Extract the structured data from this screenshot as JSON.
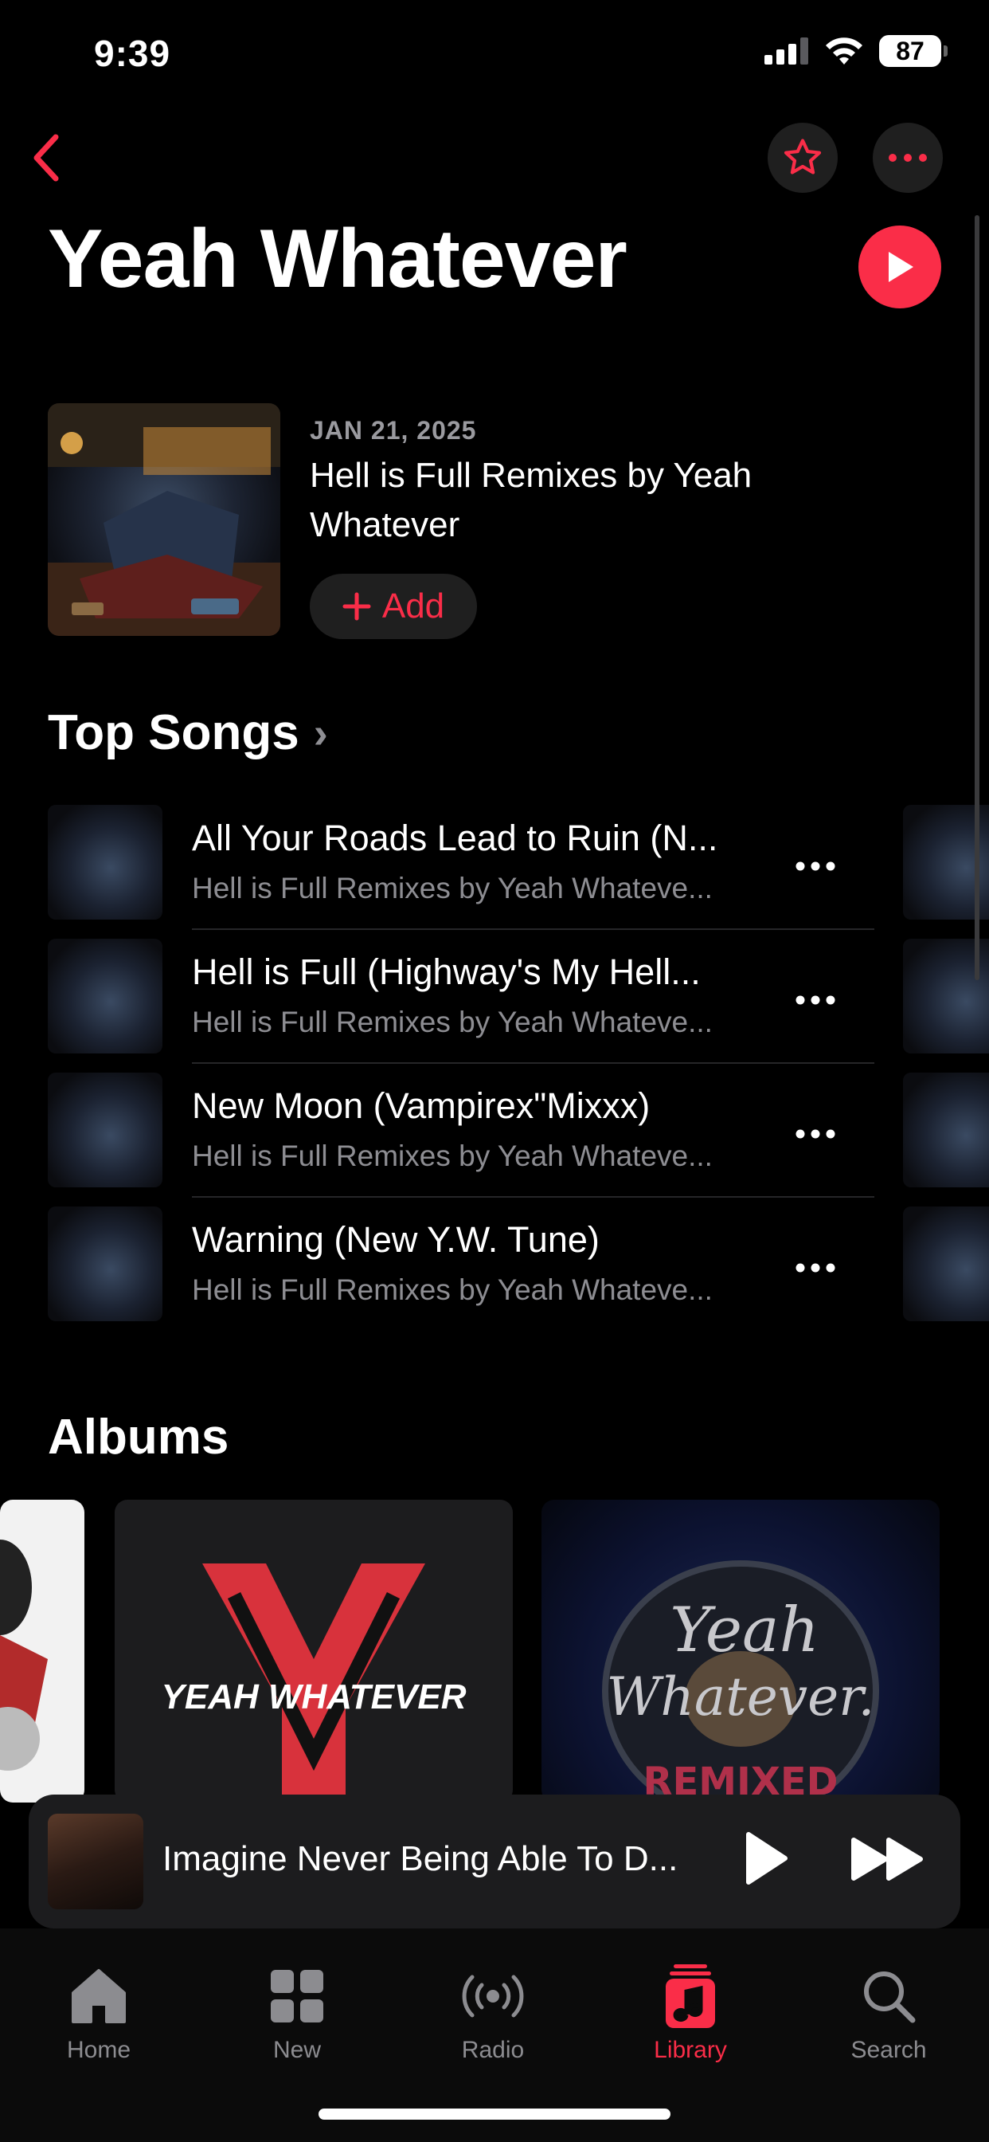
{
  "status_bar": {
    "time": "9:39",
    "battery": "87"
  },
  "header": {
    "title": "Yeah Whatever"
  },
  "latest_release": {
    "date": "JAN 21, 2025",
    "title": "Hell is Full Remixes by Yeah Whatever",
    "add_label": "Add"
  },
  "top_songs": {
    "heading": "Top Songs",
    "items": [
      {
        "title": "All Your Roads Lead to Ruin (N...",
        "subtitle": "Hell is Full Remixes by Yeah Whateve..."
      },
      {
        "title": "Hell is Full (Highway's My Hell...",
        "subtitle": "Hell is Full Remixes by Yeah Whateve..."
      },
      {
        "title": "New Moon (Vampirex\"Mixxx)",
        "subtitle": "Hell is Full Remixes by Yeah Whateve..."
      },
      {
        "title": "Warning (New Y.W. Tune)",
        "subtitle": "Hell is Full Remixes by Yeah Whateve..."
      }
    ]
  },
  "albums": {
    "heading": "Albums",
    "logo_text": "YEAH WHATEVER",
    "remixed_text_1": "Yeah",
    "remixed_text_2": "Whatever.",
    "remixed_text_3": "REMIXED"
  },
  "mini_player": {
    "title": "Imagine Never Being Able To D..."
  },
  "tabs": [
    {
      "label": "Home"
    },
    {
      "label": "New"
    },
    {
      "label": "Radio"
    },
    {
      "label": "Library"
    },
    {
      "label": "Search"
    }
  ],
  "colors": {
    "accent": "#fa2d48",
    "background": "#000000"
  }
}
